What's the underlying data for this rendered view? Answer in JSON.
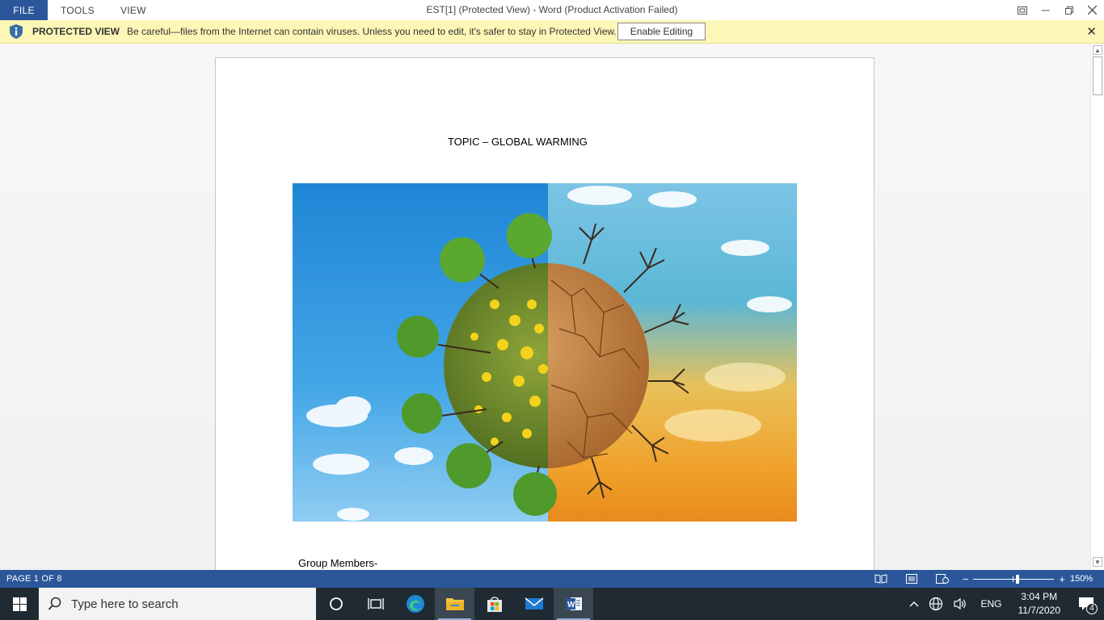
{
  "window": {
    "title": "EST[1] (Protected View) - Word (Product Activation Failed)",
    "menu": [
      "FILE",
      "TOOLS",
      "VIEW"
    ]
  },
  "protected_view": {
    "title": "PROTECTED VIEW",
    "message": "Be careful—files from the Internet can contain viruses. Unless you need to edit, it's safer to stay in Protected View.",
    "button": "Enable Editing",
    "close": "✕"
  },
  "document": {
    "title": "TOPIC – GLOBAL WARMING",
    "group_label": "Group Members-"
  },
  "status": {
    "page": "PAGE 1 OF 8",
    "zoom": "150%",
    "zoom_fraction": 0.55
  },
  "taskbar": {
    "search_placeholder": "Type here to search",
    "language": "ENG",
    "time": "3:04 PM",
    "date": "11/7/2020",
    "notifications": "4"
  },
  "colors": {
    "accent": "#2b579a",
    "protected_bar": "#fcf7b6",
    "taskbar": "#1f2a33"
  }
}
